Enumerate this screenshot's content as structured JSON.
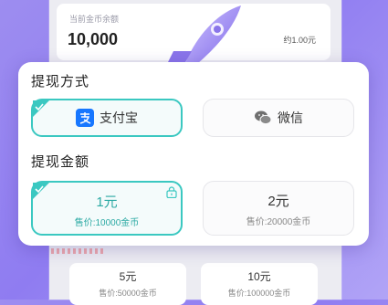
{
  "balance": {
    "label": "当前金币余额",
    "value": "10,000",
    "approx": "约1.00元"
  },
  "withdraw_method": {
    "title": "提现方式",
    "options": [
      {
        "label": "支付宝",
        "icon": "alipay-icon",
        "selected": true
      },
      {
        "label": "微信",
        "icon": "wechat-icon",
        "selected": false
      }
    ]
  },
  "withdraw_amount": {
    "title": "提现金额",
    "options": [
      {
        "amount": "1元",
        "price": "售价:10000金币",
        "selected": true,
        "locked": true
      },
      {
        "amount": "2元",
        "price": "售价:20000金币",
        "selected": false
      }
    ]
  },
  "more_amounts": [
    {
      "amount": "5元",
      "price": "售价:50000金币"
    },
    {
      "amount": "10元",
      "price": "售价:100000金币"
    }
  ],
  "colors": {
    "accent": "#3bc8c1",
    "background": "#9d8df0",
    "alipay": "#1677ff",
    "wechat": "#6f6f6f"
  }
}
